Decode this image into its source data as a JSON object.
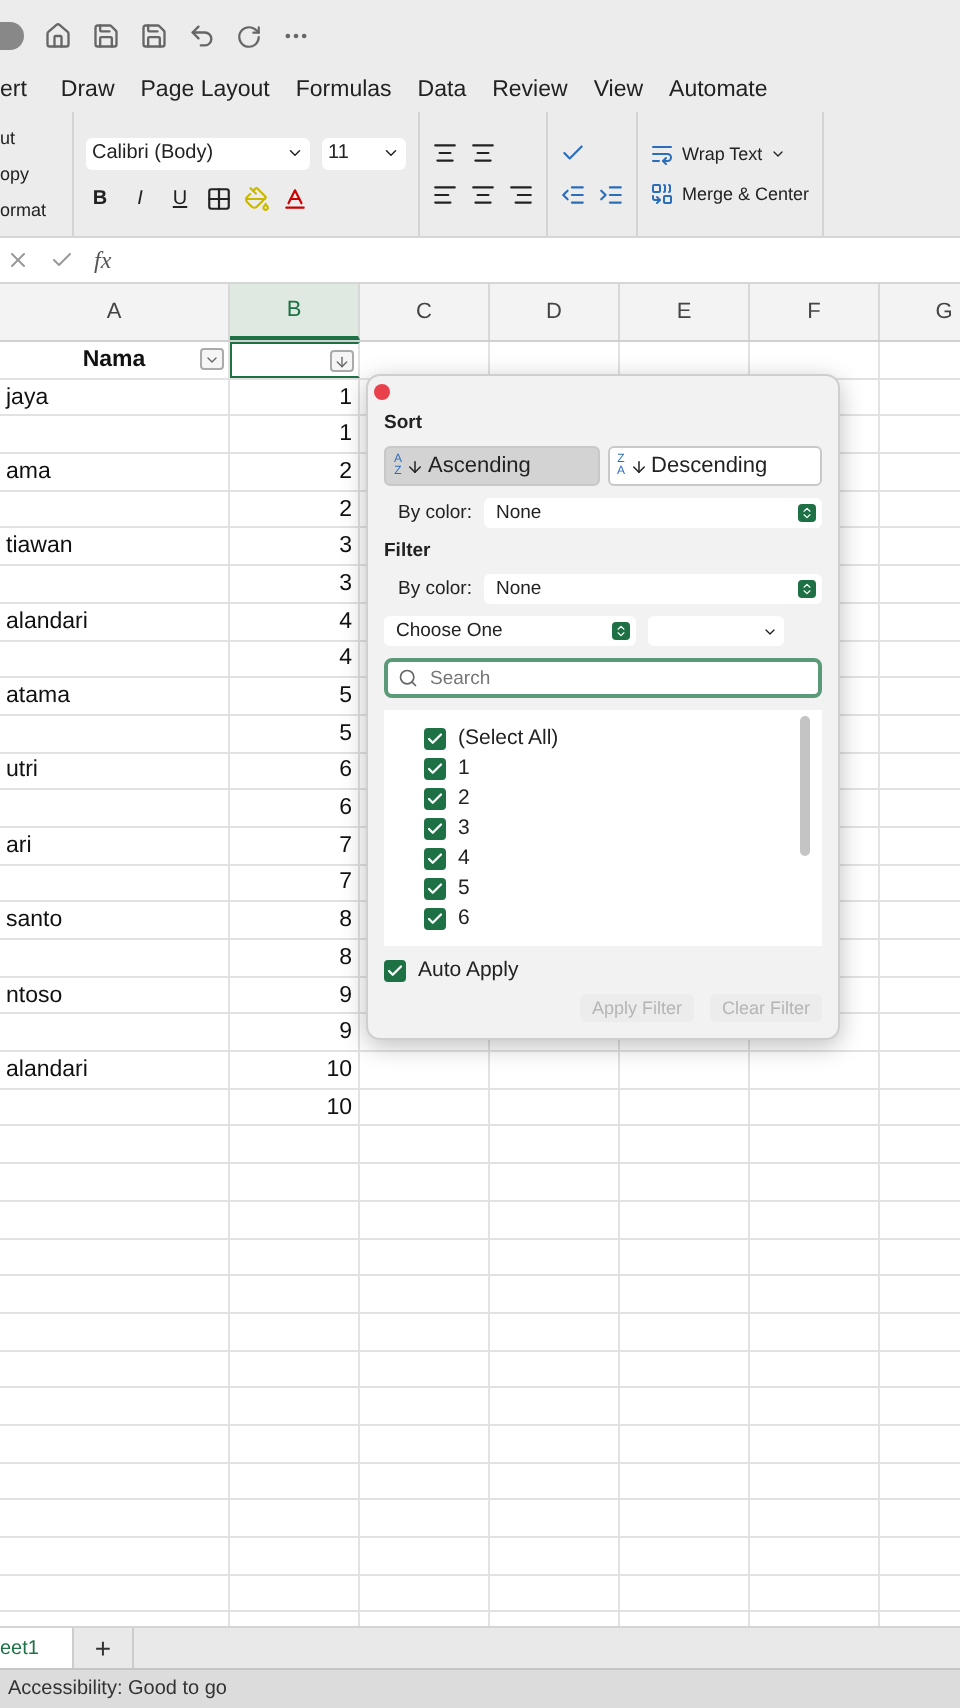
{
  "menu_tabs": [
    {
      "label": "ert",
      "selected": false
    },
    {
      "label": "Draw",
      "selected": false
    },
    {
      "label": "Page Layout",
      "selected": false
    },
    {
      "label": "Formulas",
      "selected": false
    },
    {
      "label": "Data",
      "selected": false
    },
    {
      "label": "Review",
      "selected": false
    },
    {
      "label": "View",
      "selected": false
    },
    {
      "label": "Automate",
      "selected": false
    }
  ],
  "ribbon": {
    "clipboard": [
      "ut",
      "opy",
      "ormat"
    ],
    "font_name": "Calibri (Body)",
    "font_size": "11",
    "styles": [
      "B",
      "I",
      "U"
    ],
    "wrap_text": "Wrap Text",
    "merge": "Merge & Center"
  },
  "formula_bar": {
    "fx": "fx"
  },
  "columns": [
    {
      "label": "A",
      "selected": false
    },
    {
      "label": "B",
      "selected": true
    },
    {
      "label": "C",
      "selected": false
    },
    {
      "label": "D",
      "selected": false
    },
    {
      "label": "E",
      "selected": false
    },
    {
      "label": "F",
      "selected": false
    },
    {
      "label": "G",
      "selected": false
    }
  ],
  "header_row": [
    "Nama"
  ],
  "rows": [
    {
      "name": "jaya",
      "value": "1"
    },
    {
      "name": "",
      "value": "1"
    },
    {
      "name": "ama",
      "value": "2"
    },
    {
      "name": "",
      "value": "2"
    },
    {
      "name": "tiawan",
      "value": "3"
    },
    {
      "name": "",
      "value": "3"
    },
    {
      "name": "alandari",
      "value": "4"
    },
    {
      "name": "",
      "value": "4"
    },
    {
      "name": "atama",
      "value": "5"
    },
    {
      "name": "",
      "value": "5"
    },
    {
      "name": "utri",
      "value": "6"
    },
    {
      "name": "",
      "value": "6"
    },
    {
      "name": "ari",
      "value": "7"
    },
    {
      "name": "",
      "value": "7"
    },
    {
      "name": "santo",
      "value": "8"
    },
    {
      "name": "",
      "value": "8"
    },
    {
      "name": "ntoso",
      "value": "9"
    },
    {
      "name": "",
      "value": "9"
    },
    {
      "name": "alandari",
      "value": "10"
    },
    {
      "name": "",
      "value": "10"
    }
  ],
  "filter_popup": {
    "sort_title": "Sort",
    "ascending": {
      "letters": [
        "A",
        "Z"
      ],
      "label": "Ascending",
      "selected": true
    },
    "descending": {
      "letters": [
        "Z",
        "A"
      ],
      "label": "Descending",
      "selected": false
    },
    "sort_color_label": "By color:",
    "sort_color_value": "None",
    "filter_title": "Filter",
    "filter_color_label": "By color:",
    "filter_color_value": "None",
    "condition": "Choose One",
    "search_placeholder": "Search",
    "items": [
      {
        "label": "(Select All)",
        "checked": true
      },
      {
        "label": "1",
        "checked": true
      },
      {
        "label": "2",
        "checked": true
      },
      {
        "label": "3",
        "checked": true
      },
      {
        "label": "4",
        "checked": true
      },
      {
        "label": "5",
        "checked": true
      },
      {
        "label": "6",
        "checked": true
      }
    ],
    "auto_apply": {
      "label": "Auto Apply",
      "checked": true
    },
    "apply": {
      "label": "Apply Filter",
      "disabled": true
    },
    "clear": {
      "label": "Clear Filter",
      "disabled": true
    }
  },
  "sheet_tabs": [
    {
      "label": "eet1",
      "selected": true
    }
  ],
  "add_sheet": "+",
  "status_bar": "Accessibility: Good to go"
}
